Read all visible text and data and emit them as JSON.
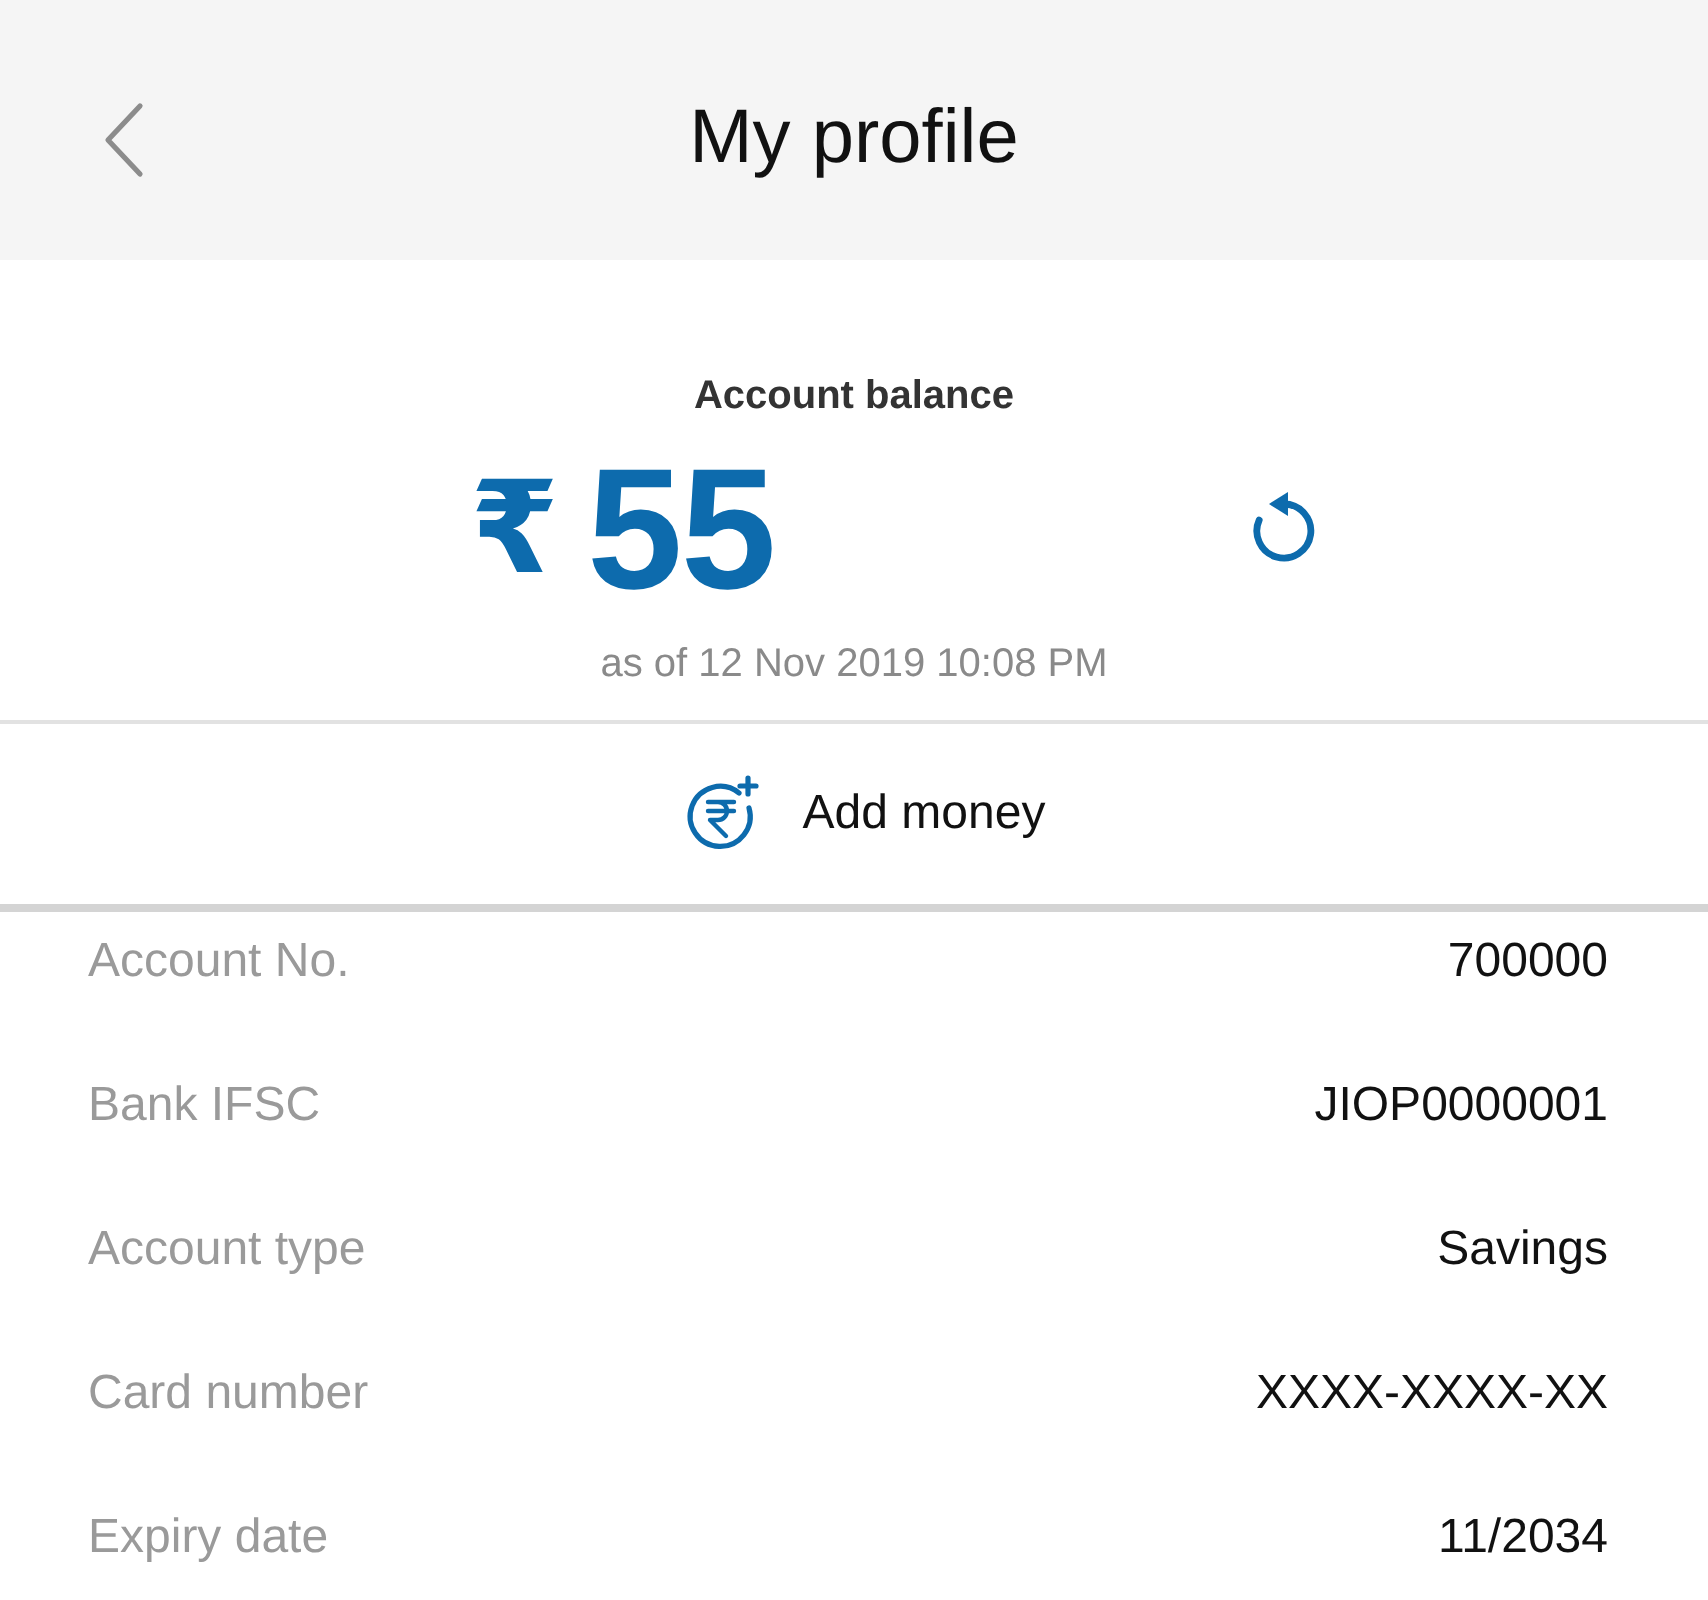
{
  "header": {
    "title": "My profile"
  },
  "balance": {
    "label": "Account balance",
    "currency": "₹",
    "amount": "55",
    "updated": "as of 12 Nov 2019 10:08 PM"
  },
  "add_money": {
    "label": "Add money"
  },
  "details": [
    {
      "label": "Account No.",
      "value": "700000"
    },
    {
      "label": "Bank IFSC",
      "value": "JIOP0000001"
    },
    {
      "label": "Account type",
      "value": "Savings"
    },
    {
      "label": "Card number",
      "value": "XXXX-XXXX-XX"
    },
    {
      "label": "Expiry date",
      "value": "11/2034"
    }
  ]
}
